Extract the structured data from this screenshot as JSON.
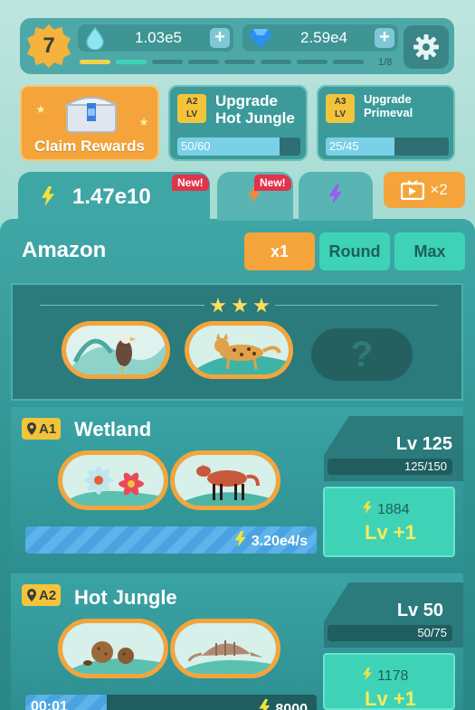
{
  "player": {
    "level": "7"
  },
  "resources": {
    "water": "1.03e5",
    "gems": "2.59e4",
    "progress_label": "1/8",
    "progress_filled": 1,
    "progress_total": 8
  },
  "cards": {
    "claim": {
      "label": "Claim Rewards"
    },
    "upgrade1": {
      "tag": "A2",
      "tag_sub": "LV",
      "title_line1": "Upgrade",
      "title_line2": "Hot Jungle",
      "progress_text": "50/60",
      "progress": 0.83
    },
    "upgrade2": {
      "tag": "A3",
      "tag_sub": "LV",
      "title_line1": "Upgrade",
      "title_line2": "Primeval",
      "progress_text": "25/45",
      "progress": 0.56
    }
  },
  "tabs": {
    "main_value": "1.47e10",
    "new_label": "New!",
    "boost_label": "×2"
  },
  "region": {
    "title": "Amazon",
    "buttons": [
      "x1",
      "Round",
      "Max"
    ],
    "stars": 3
  },
  "areas": [
    {
      "tag": "A1",
      "name": "Wetland",
      "level": "Lv 125",
      "level_progress_text": "125/150",
      "level_progress": 0.83,
      "cost": "1884",
      "upgrade_label": "Lv +1",
      "rate": "3.20e4/s",
      "rate_progress": 1.0
    },
    {
      "tag": "A2",
      "name": "Hot Jungle",
      "level": "Lv 50",
      "level_progress_text": "50/75",
      "level_progress": 0.67,
      "cost": "1178",
      "upgrade_label": "Lv +1",
      "timer": "00:01",
      "timer_value": "8000",
      "rate_progress": 0.28
    }
  ],
  "colors": {
    "accent_orange": "#f4a43a",
    "teal": "#3fa6a6",
    "new_red": "#e2334a",
    "bolt_yellow": "#f3e23d"
  }
}
